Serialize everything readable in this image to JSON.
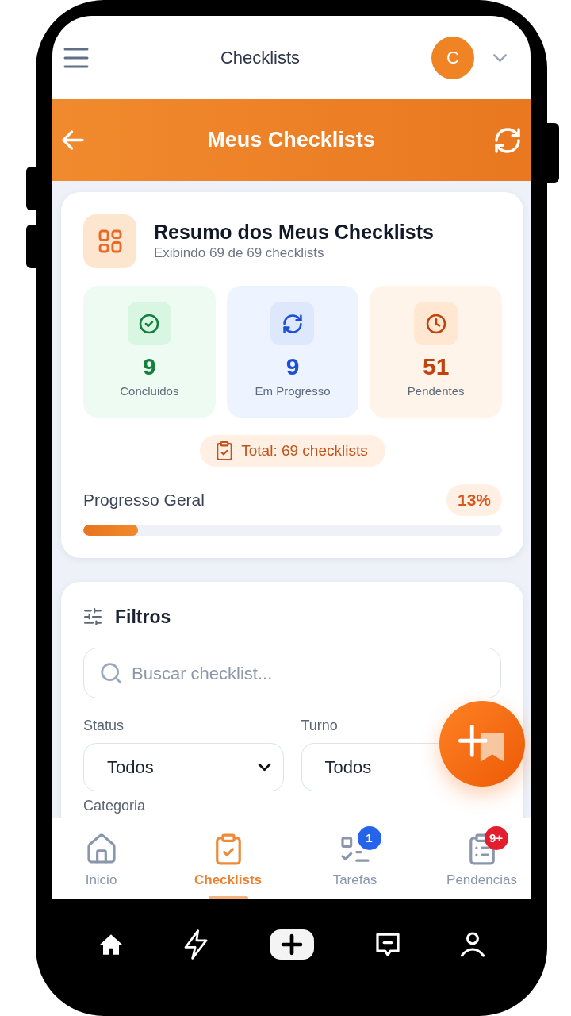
{
  "header": {
    "title": "Checklists",
    "avatar": "C"
  },
  "page_bar": {
    "title": "Meus Checklists"
  },
  "summary": {
    "title": "Resumo dos Meus Checklists",
    "subtitle": "Exibindo 69 de 69 checklists",
    "stats": [
      {
        "kind": "done",
        "value": "9",
        "label": "Concluidos",
        "color": "#15803d"
      },
      {
        "kind": "in_progress",
        "value": "9",
        "label": "Em Progresso",
        "color": "#1d4ed8"
      },
      {
        "kind": "pending",
        "value": "51",
        "label": "Pendentes",
        "color": "#c2410c"
      }
    ],
    "total": "Total: 69 checklists",
    "progress": {
      "label": "Progresso Geral",
      "reading": "13%",
      "level": 0.13
    }
  },
  "filters": {
    "title": "Filtros",
    "search": {
      "placeholder": "Buscar checklist..."
    },
    "fields": [
      {
        "label": "Status",
        "value": "Todos"
      },
      {
        "label": "Turno",
        "value": "Todos"
      },
      {
        "label": "Categoria"
      }
    ]
  },
  "bottom_nav": [
    {
      "kind": "home",
      "label": "Inicio",
      "selected": false
    },
    {
      "kind": "checklist",
      "label": "Checklists",
      "selected": true
    },
    {
      "kind": "tasks",
      "label": "Tarefas",
      "selected": false,
      "badge": {
        "text": "1",
        "color": "#2563eb"
      }
    },
    {
      "kind": "pending",
      "label": "Pendencias",
      "selected": false,
      "badge": {
        "text": "9+",
        "color": "#e11d2e"
      }
    }
  ]
}
